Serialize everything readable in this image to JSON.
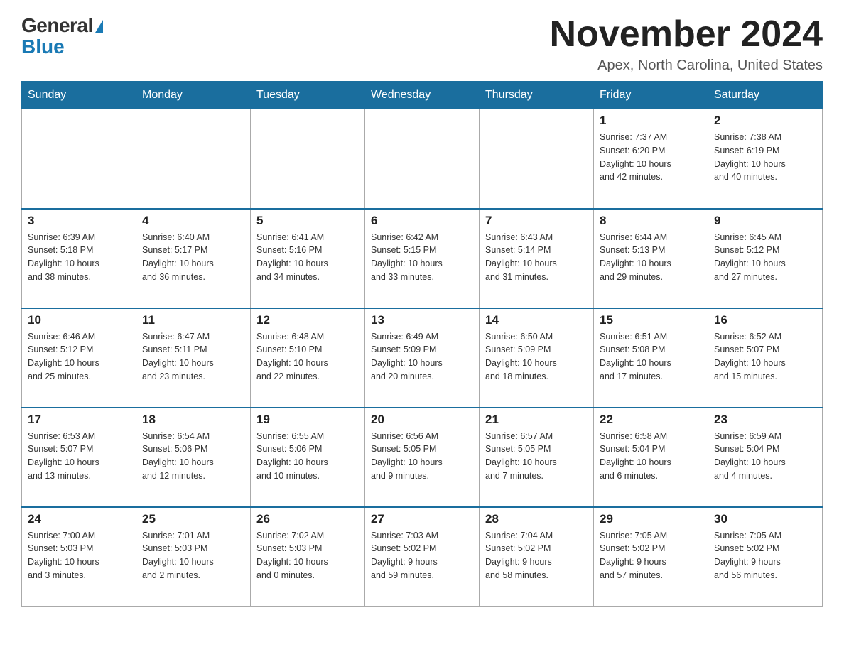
{
  "header": {
    "logo_general": "General",
    "logo_blue": "Blue",
    "title": "November 2024",
    "location": "Apex, North Carolina, United States"
  },
  "weekdays": [
    "Sunday",
    "Monday",
    "Tuesday",
    "Wednesday",
    "Thursday",
    "Friday",
    "Saturday"
  ],
  "weeks": [
    [
      {
        "day": "",
        "info": ""
      },
      {
        "day": "",
        "info": ""
      },
      {
        "day": "",
        "info": ""
      },
      {
        "day": "",
        "info": ""
      },
      {
        "day": "",
        "info": ""
      },
      {
        "day": "1",
        "info": "Sunrise: 7:37 AM\nSunset: 6:20 PM\nDaylight: 10 hours\nand 42 minutes."
      },
      {
        "day": "2",
        "info": "Sunrise: 7:38 AM\nSunset: 6:19 PM\nDaylight: 10 hours\nand 40 minutes."
      }
    ],
    [
      {
        "day": "3",
        "info": "Sunrise: 6:39 AM\nSunset: 5:18 PM\nDaylight: 10 hours\nand 38 minutes."
      },
      {
        "day": "4",
        "info": "Sunrise: 6:40 AM\nSunset: 5:17 PM\nDaylight: 10 hours\nand 36 minutes."
      },
      {
        "day": "5",
        "info": "Sunrise: 6:41 AM\nSunset: 5:16 PM\nDaylight: 10 hours\nand 34 minutes."
      },
      {
        "day": "6",
        "info": "Sunrise: 6:42 AM\nSunset: 5:15 PM\nDaylight: 10 hours\nand 33 minutes."
      },
      {
        "day": "7",
        "info": "Sunrise: 6:43 AM\nSunset: 5:14 PM\nDaylight: 10 hours\nand 31 minutes."
      },
      {
        "day": "8",
        "info": "Sunrise: 6:44 AM\nSunset: 5:13 PM\nDaylight: 10 hours\nand 29 minutes."
      },
      {
        "day": "9",
        "info": "Sunrise: 6:45 AM\nSunset: 5:12 PM\nDaylight: 10 hours\nand 27 minutes."
      }
    ],
    [
      {
        "day": "10",
        "info": "Sunrise: 6:46 AM\nSunset: 5:12 PM\nDaylight: 10 hours\nand 25 minutes."
      },
      {
        "day": "11",
        "info": "Sunrise: 6:47 AM\nSunset: 5:11 PM\nDaylight: 10 hours\nand 23 minutes."
      },
      {
        "day": "12",
        "info": "Sunrise: 6:48 AM\nSunset: 5:10 PM\nDaylight: 10 hours\nand 22 minutes."
      },
      {
        "day": "13",
        "info": "Sunrise: 6:49 AM\nSunset: 5:09 PM\nDaylight: 10 hours\nand 20 minutes."
      },
      {
        "day": "14",
        "info": "Sunrise: 6:50 AM\nSunset: 5:09 PM\nDaylight: 10 hours\nand 18 minutes."
      },
      {
        "day": "15",
        "info": "Sunrise: 6:51 AM\nSunset: 5:08 PM\nDaylight: 10 hours\nand 17 minutes."
      },
      {
        "day": "16",
        "info": "Sunrise: 6:52 AM\nSunset: 5:07 PM\nDaylight: 10 hours\nand 15 minutes."
      }
    ],
    [
      {
        "day": "17",
        "info": "Sunrise: 6:53 AM\nSunset: 5:07 PM\nDaylight: 10 hours\nand 13 minutes."
      },
      {
        "day": "18",
        "info": "Sunrise: 6:54 AM\nSunset: 5:06 PM\nDaylight: 10 hours\nand 12 minutes."
      },
      {
        "day": "19",
        "info": "Sunrise: 6:55 AM\nSunset: 5:06 PM\nDaylight: 10 hours\nand 10 minutes."
      },
      {
        "day": "20",
        "info": "Sunrise: 6:56 AM\nSunset: 5:05 PM\nDaylight: 10 hours\nand 9 minutes."
      },
      {
        "day": "21",
        "info": "Sunrise: 6:57 AM\nSunset: 5:05 PM\nDaylight: 10 hours\nand 7 minutes."
      },
      {
        "day": "22",
        "info": "Sunrise: 6:58 AM\nSunset: 5:04 PM\nDaylight: 10 hours\nand 6 minutes."
      },
      {
        "day": "23",
        "info": "Sunrise: 6:59 AM\nSunset: 5:04 PM\nDaylight: 10 hours\nand 4 minutes."
      }
    ],
    [
      {
        "day": "24",
        "info": "Sunrise: 7:00 AM\nSunset: 5:03 PM\nDaylight: 10 hours\nand 3 minutes."
      },
      {
        "day": "25",
        "info": "Sunrise: 7:01 AM\nSunset: 5:03 PM\nDaylight: 10 hours\nand 2 minutes."
      },
      {
        "day": "26",
        "info": "Sunrise: 7:02 AM\nSunset: 5:03 PM\nDaylight: 10 hours\nand 0 minutes."
      },
      {
        "day": "27",
        "info": "Sunrise: 7:03 AM\nSunset: 5:02 PM\nDaylight: 9 hours\nand 59 minutes."
      },
      {
        "day": "28",
        "info": "Sunrise: 7:04 AM\nSunset: 5:02 PM\nDaylight: 9 hours\nand 58 minutes."
      },
      {
        "day": "29",
        "info": "Sunrise: 7:05 AM\nSunset: 5:02 PM\nDaylight: 9 hours\nand 57 minutes."
      },
      {
        "day": "30",
        "info": "Sunrise: 7:05 AM\nSunset: 5:02 PM\nDaylight: 9 hours\nand 56 minutes."
      }
    ]
  ]
}
